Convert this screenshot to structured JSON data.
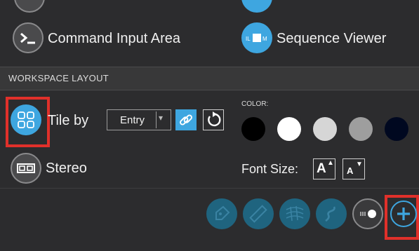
{
  "items": {
    "command_input": {
      "label": "Command Input Area",
      "icon": "terminal-icon"
    },
    "sequence_viewer": {
      "label": "Sequence Viewer",
      "icon": "sequence-viewer-icon"
    }
  },
  "workspace_layout": {
    "section_title": "WORKSPACE LAYOUT",
    "tile_by": {
      "label": "Tile by",
      "icon": "tile-grid-icon",
      "selected": "Entry"
    },
    "link_icon": "link-icon",
    "reset_icon": "reset-rotate-icon",
    "stereo": {
      "label": "Stereo",
      "icon": "stereo-glasses-icon"
    },
    "color": {
      "label": "COLOR:",
      "swatches": [
        "#000000",
        "#ffffff",
        "#d6d6d6",
        "#9e9e9e",
        "#000820"
      ]
    },
    "font_size": {
      "label": "Font Size:",
      "increase": "A",
      "decrease": "A"
    }
  },
  "toolbar": {
    "tools": [
      "tag-icon",
      "ruler-icon",
      "mesh-icon",
      "squiggle-icon",
      "toggle-icon"
    ],
    "add_icon": "plus-icon"
  },
  "colors": {
    "accent": "#3ea6e0",
    "highlight": "#e0302a"
  }
}
